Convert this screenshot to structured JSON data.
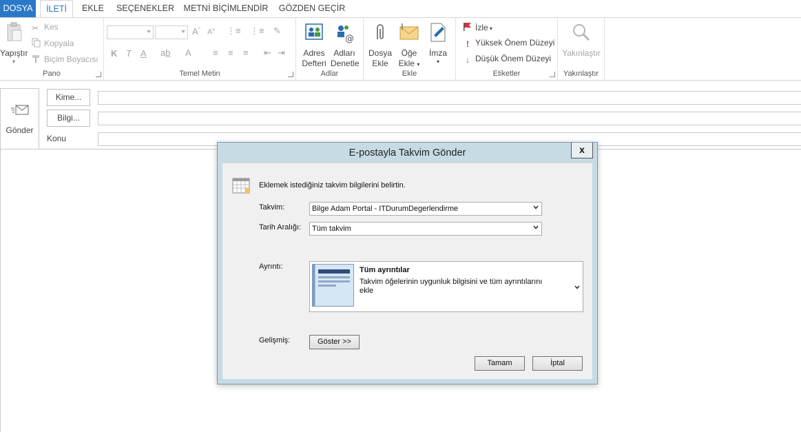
{
  "tabs": [
    "DOSYA",
    "İLETİ",
    "EKLE",
    "SEÇENEKLER",
    "METNİ BİÇİMLENDİR",
    "GÖZDEN GEÇİR"
  ],
  "ribbon": {
    "pano": {
      "label": "Pano",
      "paste": "Yapıştır",
      "cut": "Kes",
      "copy": "Kopyala",
      "format_painter": "Biçim Boyacısı"
    },
    "temel_metin": {
      "label": "Temel Metin",
      "bold": "K",
      "italic": "T",
      "underline": "A",
      "font_color": "A"
    },
    "adlar": {
      "label": "Adlar",
      "address_book_1": "Adres",
      "address_book_2": "Defteri",
      "check_names_1": "Adları",
      "check_names_2": "Denetle"
    },
    "ekle": {
      "label": "Ekle",
      "attach_file_1": "Dosya",
      "attach_file_2": "Ekle",
      "attach_item_1": "Öğe",
      "attach_item_2": "Ekle",
      "signature": "İmza"
    },
    "etiketler": {
      "label": "Etiketler",
      "follow_up": "İzle",
      "high_importance": "Yüksek Önem Düzeyi",
      "low_importance": "Düşük Önem Düzeyi"
    },
    "yakinlastir": {
      "label": "Yakınlaştır",
      "zoom": "Yakınlaştır"
    }
  },
  "compose": {
    "send": "Gönder",
    "to": "Kime...",
    "cc": "Bilgi...",
    "subject": "Konu"
  },
  "dialog": {
    "title": "E-postayla Takvim Gönder",
    "close": "x",
    "instruction": "Eklemek istediğiniz takvim bilgilerini belirtin.",
    "calendar_label": "Takvim:",
    "calendar_value": "Bilge Adam Portal - ITDurumDegerlendirme",
    "date_range_label": "Tarih Aralığı:",
    "date_range_value": "Tüm takvim",
    "detail_label": "Ayrıntı:",
    "detail_title": "Tüm ayrıntılar",
    "detail_desc_1": "Takvim öğelerinin uygunluk bilgisini ve tüm ayrıntılarını",
    "detail_desc_2": "ekle",
    "advanced_label": "Gelişmiş:",
    "show_button": "Göster >>",
    "ok_button": "Tamam",
    "cancel_button": "İptal"
  },
  "colors": {
    "accent": "#2b78c8",
    "dialog_frame": "#c7dbe4",
    "high_importance": "#d13438",
    "low_importance": "#2b78c8"
  }
}
